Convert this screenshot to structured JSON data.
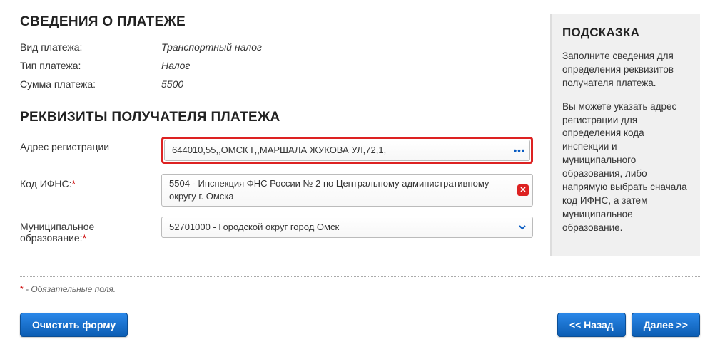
{
  "payment_info": {
    "heading": "СВЕДЕНИЯ О ПЛАТЕЖЕ",
    "rows": [
      {
        "label": "Вид платежа:",
        "value": "Транспортный налог"
      },
      {
        "label": "Тип платежа:",
        "value": "Налог"
      },
      {
        "label": "Сумма платежа:",
        "value": "5500"
      }
    ]
  },
  "recipient": {
    "heading": "РЕКВИЗИТЫ ПОЛУЧАТЕЛЯ ПЛАТЕЖА",
    "address": {
      "label": "Адрес регистрации",
      "value": "644010,55,,ОМСК Г,,МАРШАЛА ЖУКОВА УЛ,72,1,"
    },
    "ifns": {
      "label": "Код ИФНС:",
      "value": "5504 - Инспекция ФНС России № 2 по Центральному административному округу г. Омска"
    },
    "municipality": {
      "label": "Муниципальное образование:",
      "value": "52701000 - Городской округ город Омск"
    }
  },
  "hint": {
    "title": "ПОДСКАЗКА",
    "p1": "Заполните сведения для определения реквизитов получателя платежа.",
    "p2": "Вы можете указать адрес регистрации для определения кода инспекции и муниципального образования, либо напрямую выбрать сначала код ИФНС, а затем муниципальное образование."
  },
  "footnote": " - Обязательные поля.",
  "buttons": {
    "clear": "Очистить форму",
    "back": "<< Назад",
    "next": "Далее >>"
  },
  "req_mark": "*"
}
